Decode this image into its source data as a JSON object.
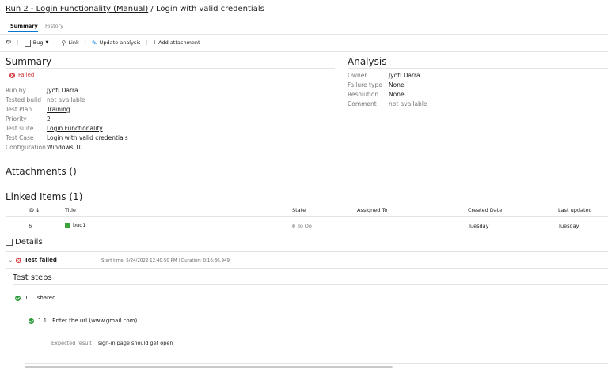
{
  "title": {
    "run_link": "Run 2 - Login Functionality (Manual)",
    "separator": " / ",
    "case": "Login with valid credentials"
  },
  "tabs": [
    {
      "label": "Summary"
    },
    {
      "label": "History"
    }
  ],
  "toolbar": {
    "bug_label": "Bug",
    "link_label": "Link",
    "update_label": "Update analysis",
    "attach_label": "Add attachment"
  },
  "summary": {
    "heading": "Summary",
    "status": "Failed",
    "fields": [
      {
        "label": "Run by",
        "value": "Jyoti Darra"
      },
      {
        "label": "Tested build",
        "value": "not available"
      },
      {
        "label": "Test Plan",
        "value": "Training"
      },
      {
        "label": "Priority",
        "value": "2"
      },
      {
        "label": "Test suite",
        "value": "Login Functionality"
      },
      {
        "label": "Test Case",
        "value": "Login with valid credentials"
      },
      {
        "label": "Configuration",
        "value": "Windows 10"
      }
    ]
  },
  "analysis": {
    "heading": "Analysis",
    "fields": [
      {
        "label": "Owner",
        "value": "Jyoti Darra"
      },
      {
        "label": "Failure type",
        "value": "None"
      },
      {
        "label": "Resolution",
        "value": "None"
      },
      {
        "label": "Comment",
        "value": "not available"
      }
    ]
  },
  "attachments": {
    "heading": "Attachments ()"
  },
  "linked": {
    "heading": "Linked Items (1)",
    "columns": {
      "id": "ID",
      "title": "Title",
      "state": "State",
      "assigned": "Assigned To",
      "created": "Created Date",
      "updated": "Last updated"
    },
    "rows": [
      {
        "id": "6",
        "title": "bug1",
        "more": "···",
        "state": "To Do",
        "assigned": "",
        "created": "Tuesday",
        "updated": "Tuesday"
      }
    ]
  },
  "details": {
    "heading": "Details",
    "result": "Test failed",
    "meta": "Start time: 5/24/2022 12:40:50 PM | Duration: 0:16:36.949",
    "steps_heading": "Test steps",
    "steps": [
      {
        "num": "1.",
        "text": "shared"
      },
      {
        "num": "1.1",
        "text": "Enter the url (www.gmail.com)"
      }
    ],
    "expected_label": "Expected result",
    "expected_value": "sign-in page should get open"
  }
}
